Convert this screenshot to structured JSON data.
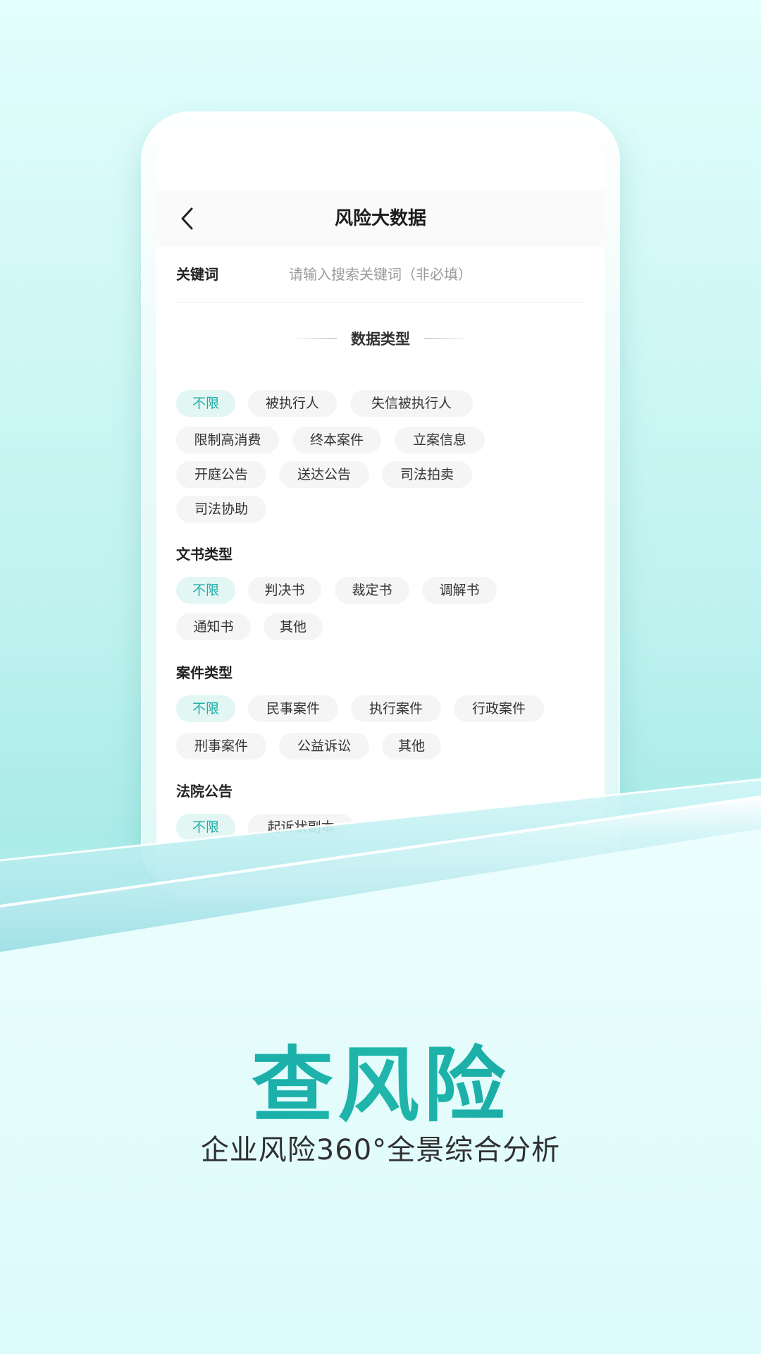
{
  "header": {
    "title": "风险大数据"
  },
  "keyword": {
    "label": "关键词",
    "placeholder": "请输入搜索关键词（非必填）",
    "value": ""
  },
  "data_type_section": {
    "title": "数据类型",
    "tags": [
      "不限",
      "被执行人",
      "失信被执行人",
      "限制高消费",
      "终本案件",
      "立案信息",
      "开庭公告",
      "送达公告",
      "司法拍卖",
      "司法协助"
    ],
    "selected": "不限"
  },
  "document_type": {
    "label": "文书类型",
    "tags": [
      "不限",
      "判决书",
      "裁定书",
      "调解书",
      "通知书",
      "其他"
    ],
    "selected": "不限"
  },
  "case_type": {
    "label": "案件类型",
    "tags": [
      "不限",
      "民事案件",
      "执行案件",
      "行政案件",
      "刑事案件",
      "公益诉讼",
      "其他"
    ],
    "selected": "不限"
  },
  "court_notice": {
    "label": "法院公告",
    "tags": [
      "不限",
      "起诉状副本"
    ],
    "selected": "不限"
  },
  "promo": {
    "title": "查风险",
    "subtitle": "企业风险360°全景综合分析"
  },
  "colors": {
    "accent": "#1fada6",
    "accent_bg": "#e2f6f4",
    "tag_bg": "#f5f5f5",
    "hero_gradient_start": "#0fa0a5",
    "hero_gradient_end": "#20b6ab"
  },
  "icons": {
    "back": "chevron-left-icon"
  }
}
